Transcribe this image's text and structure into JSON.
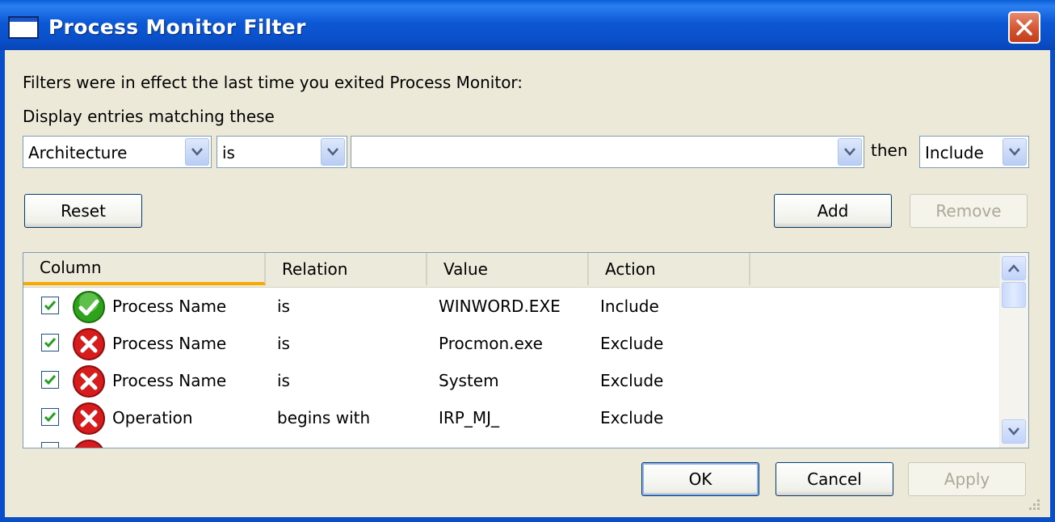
{
  "window": {
    "title": "Process Monitor Filter",
    "close_label": "close"
  },
  "intro_text": "Filters were in effect the last time you exited Process Monitor:",
  "display_label": "Display entries matching these",
  "filter_builder": {
    "column_value": "Architecture",
    "relation_value": "is",
    "value_value": "",
    "then_label": "then",
    "action_value": "Include"
  },
  "buttons": {
    "reset": "Reset",
    "add": "Add",
    "remove": "Remove",
    "ok": "OK",
    "cancel": "Cancel",
    "apply": "Apply"
  },
  "table": {
    "headers": [
      "Column",
      "Relation",
      "Value",
      "Action"
    ],
    "rows": [
      {
        "checked": true,
        "icon": "include-check-icon",
        "column": "Process Name",
        "relation": "is",
        "value": "WINWORD.EXE",
        "action": "Include"
      },
      {
        "checked": true,
        "icon": "exclude-x-icon",
        "column": "Process Name",
        "relation": "is",
        "value": "Procmon.exe",
        "action": "Exclude"
      },
      {
        "checked": true,
        "icon": "exclude-x-icon",
        "column": "Process Name",
        "relation": "is",
        "value": "System",
        "action": "Exclude"
      },
      {
        "checked": true,
        "icon": "exclude-x-icon",
        "column": "Operation",
        "relation": "begins with",
        "value": "IRP_MJ_",
        "action": "Exclude"
      }
    ]
  },
  "colors": {
    "titlebar": "#0a4fc8",
    "dialog_bg": "#ece9d8",
    "include_icon": "#2ea21a",
    "exclude_icon": "#d61c1c"
  }
}
